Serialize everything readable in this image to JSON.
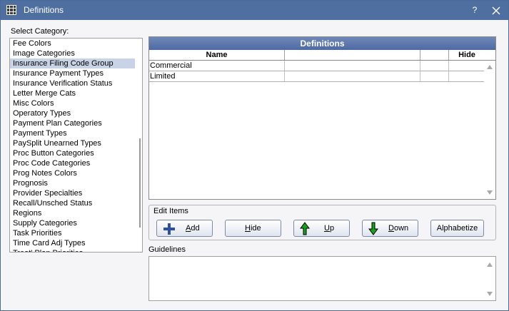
{
  "window": {
    "title": "Definitions",
    "help_label": "?"
  },
  "category": {
    "label": "Select Category:",
    "items": [
      "Fee Colors",
      "Image Categories",
      "Insurance Filing Code Group",
      "Insurance Payment Types",
      "Insurance Verification Status",
      "Letter Merge Cats",
      "Misc Colors",
      "Operatory Types",
      "Payment Plan Categories",
      "Payment Types",
      "PaySplit Unearned Types",
      "Proc Button Categories",
      "Proc Code Categories",
      "Prog Notes Colors",
      "Prognosis",
      "Provider Specialties",
      "Recall/Unsched Status",
      "Regions",
      "Supply Categories",
      "Task Priorities",
      "Time Card Adj Types",
      "Treat' Plan Priorities"
    ],
    "selected_index": 2
  },
  "grid": {
    "title": "Definitions",
    "columns": [
      "Name",
      "",
      "",
      "Hide"
    ],
    "rows": [
      [
        "Commercial",
        "",
        "",
        ""
      ],
      [
        "Limited",
        "",
        "",
        ""
      ]
    ]
  },
  "edit": {
    "label": "Edit Items",
    "add_label": "Add",
    "add_key": "A",
    "hide_label": "Hide",
    "hide_key": "H",
    "up_label": "Up",
    "up_key": "U",
    "down_label": "Down",
    "down_key": "D",
    "alphabetize_label": "Alphabetize"
  },
  "guidelines": {
    "label": "Guidelines",
    "text": ""
  },
  "colors": {
    "titlebar": "#4f6fa0",
    "selection": "#c8d3e6",
    "add_icon": "#2f4fa0",
    "arrow_icon": "#1aa01a"
  }
}
